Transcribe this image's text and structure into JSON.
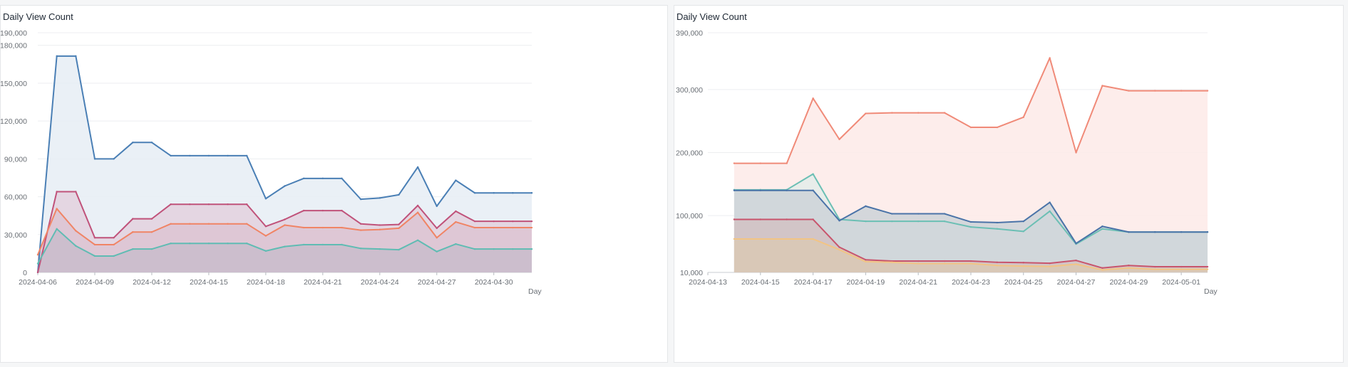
{
  "panels": [
    {
      "title": "Daily View Count"
    },
    {
      "title": "Daily View Count"
    }
  ],
  "chart_data": [
    {
      "type": "area",
      "title": "Daily View Count",
      "xlabel": "Day",
      "ylabel": "",
      "y_ticks": [
        0,
        30000,
        60000,
        90000,
        120000,
        150000,
        180000,
        190000
      ],
      "y_tick_labels": [
        "0",
        "30,000",
        "60,000",
        "90,000",
        "120,000",
        "150,000",
        "180,000",
        "190,000"
      ],
      "ylim": [
        0,
        190000
      ],
      "x_tick_labels": [
        "2024-04-06",
        "2024-04-09",
        "2024-04-12",
        "2024-04-15",
        "2024-04-18",
        "2024-04-21",
        "2024-04-24",
        "2024-04-27",
        "2024-04-30"
      ],
      "x": [
        "2024-04-06",
        "2024-04-07",
        "2024-04-08",
        "2024-04-09",
        "2024-04-10",
        "2024-04-11",
        "2024-04-12",
        "2024-04-13",
        "2024-04-14",
        "2024-04-15",
        "2024-04-16",
        "2024-04-17",
        "2024-04-18",
        "2024-04-19",
        "2024-04-20",
        "2024-04-21",
        "2024-04-22",
        "2024-04-23",
        "2024-04-24",
        "2024-04-25",
        "2024-04-26",
        "2024-04-27",
        "2024-04-28",
        "2024-04-29",
        "2024-04-30",
        "2024-05-01",
        "2024-05-02"
      ],
      "grid": true,
      "series": [
        {
          "color": "#4a7fb5",
          "fill": "#e6edf5",
          "values": [
            0,
            171500,
            171500,
            90000,
            90000,
            103000,
            103000,
            92500,
            92500,
            92500,
            92500,
            92500,
            58500,
            68500,
            74500,
            74500,
            74500,
            58000,
            59000,
            61500,
            83500,
            52500,
            73000,
            63000,
            63000,
            63000,
            63000
          ]
        },
        {
          "color": "#c0527a",
          "fill": "#e3d1de",
          "values": [
            0,
            64000,
            64000,
            27500,
            27500,
            42500,
            42500,
            54000,
            54000,
            54000,
            54000,
            54000,
            36500,
            42000,
            49000,
            49000,
            49000,
            38500,
            37500,
            38000,
            53000,
            35000,
            48500,
            40500,
            40500,
            40500,
            40500
          ]
        },
        {
          "color": "#f08465",
          "fill": "#ddc4d2",
          "values": [
            14000,
            50500,
            33000,
            22000,
            22000,
            32000,
            32000,
            38500,
            38500,
            38500,
            38500,
            38500,
            29000,
            37500,
            35500,
            35500,
            35500,
            33500,
            34000,
            35000,
            47500,
            27500,
            40000,
            35500,
            35500,
            35500,
            35500
          ]
        },
        {
          "color": "#5fbcb3",
          "fill": "#c9bccb",
          "values": [
            7000,
            34500,
            21000,
            13000,
            13000,
            18500,
            18500,
            23000,
            23000,
            23000,
            23000,
            23000,
            17000,
            20500,
            22000,
            22000,
            22000,
            19000,
            18500,
            18000,
            25500,
            16500,
            22500,
            18500,
            18500,
            18500,
            18500
          ]
        }
      ]
    },
    {
      "type": "area",
      "title": "Daily View Count",
      "xlabel": "Day",
      "ylabel": "",
      "y_ticks": [
        10000,
        100000,
        200000,
        300000,
        390000
      ],
      "y_tick_labels": [
        "10,000",
        "100,000",
        "200,000",
        "300,000",
        "390,000"
      ],
      "ylim": [
        10000,
        390000
      ],
      "x_tick_labels": [
        "2024-04-13",
        "2024-04-15",
        "2024-04-17",
        "2024-04-19",
        "2024-04-21",
        "2024-04-23",
        "2024-04-25",
        "2024-04-27",
        "2024-04-29",
        "2024-05-01"
      ],
      "x": [
        "2024-04-14",
        "2024-04-15",
        "2024-04-16",
        "2024-04-17",
        "2024-04-18",
        "2024-04-19",
        "2024-04-20",
        "2024-04-21",
        "2024-04-22",
        "2024-04-23",
        "2024-04-24",
        "2024-04-25",
        "2024-04-26",
        "2024-04-27",
        "2024-04-28",
        "2024-04-29",
        "2024-04-30",
        "2024-05-01",
        "2024-05-02"
      ],
      "grid": true,
      "series": [
        {
          "color": "#f08a78",
          "fill": "#fdeae8",
          "values": [
            183000,
            183000,
            183000,
            286000,
            221000,
            262000,
            263000,
            263000,
            263000,
            240000,
            240000,
            256000,
            350000,
            200000,
            306000,
            298000,
            298000,
            298000,
            298000
          ]
        },
        {
          "color": "#6bbfb4",
          "fill": "#e4ecea",
          "values": [
            141000,
            141000,
            141000,
            166000,
            94000,
            91000,
            91000,
            91000,
            91000,
            82000,
            79000,
            75000,
            107000,
            55000,
            79000,
            74000,
            74000,
            74000,
            74000
          ]
        },
        {
          "color": "#4a73a8",
          "fill": "#ccd2d8",
          "values": [
            140000,
            140000,
            140000,
            140000,
            92000,
            115000,
            103000,
            103000,
            103000,
            90000,
            89000,
            91000,
            121000,
            56000,
            83000,
            74000,
            74000,
            74000,
            74000
          ]
        },
        {
          "color": "#c8546c",
          "fill": "#d2c2c3",
          "values": [
            94000,
            94000,
            94000,
            94000,
            50000,
            30000,
            28000,
            28000,
            28000,
            28000,
            26000,
            25500,
            24500,
            29000,
            17000,
            21000,
            19000,
            19000,
            19000
          ]
        },
        {
          "color": "#f2c484",
          "fill": "#dac8b4",
          "values": [
            63000,
            63000,
            63000,
            63000,
            46000,
            27000,
            26000,
            24000,
            24000,
            24000,
            21000,
            20000,
            19500,
            23000,
            14000,
            17000,
            15000,
            15000,
            15000
          ]
        }
      ]
    }
  ]
}
